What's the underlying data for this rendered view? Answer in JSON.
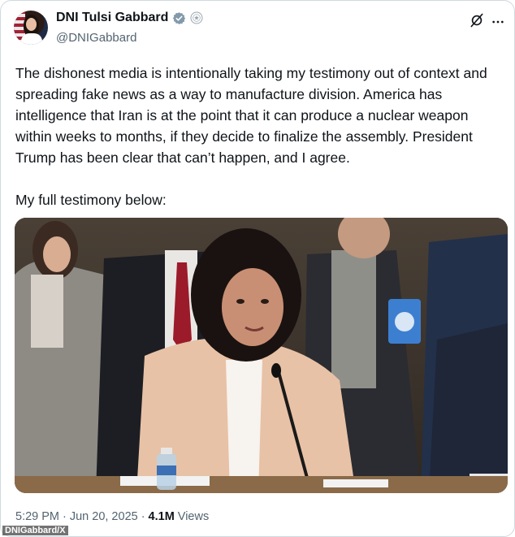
{
  "author": {
    "display_name": "DNI Tulsi Gabbard",
    "handle": "@DNIGabbard",
    "verified_color": "#829aab",
    "avatar_icon": "profile-photo-with-us-flag"
  },
  "header_icons": {
    "grok": "grok-icon",
    "more": "more-options-icon"
  },
  "tweet": {
    "text": "The dishonest media is intentionally taking my testimony out of context and spreading fake news as a way to manufacture division. America has intelligence that Iran is at the point that it can produce a nuclear weapon within weeks to months, if they decide to finalize the assembly. President Trump has been clear that can’t happen, and I agree.\n\nMy full testimony below:"
  },
  "media": {
    "kind": "photo"
  },
  "meta": {
    "time": "5:29 PM",
    "separator": "·",
    "date": "Jun 20, 2025",
    "separator2": "·",
    "views_count": "4.1M",
    "views_label": "Views"
  },
  "credit": "DNIGabbard/X",
  "colors": {
    "text": "#0f1419",
    "secondary": "#536471",
    "border": "#cfd9de"
  }
}
